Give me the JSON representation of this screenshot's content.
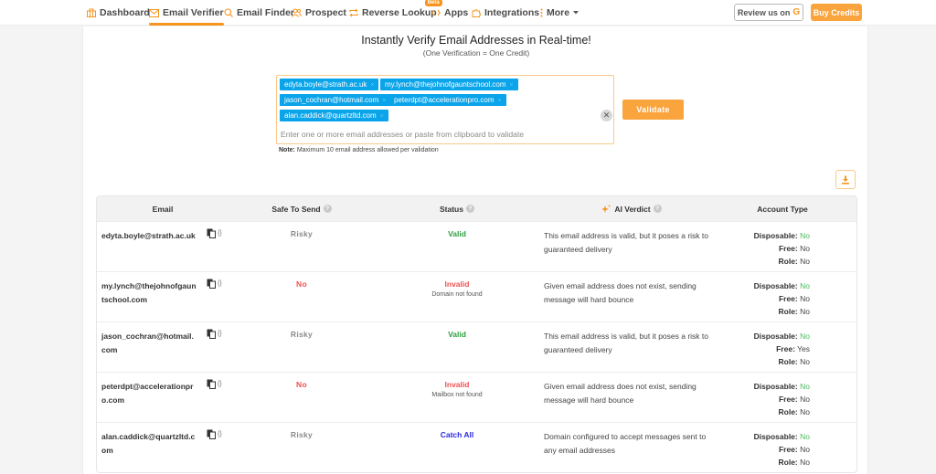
{
  "nav": {
    "items": [
      {
        "label": "Dashboard",
        "icon": "dashboard-icon",
        "active": false
      },
      {
        "label": "Email Verifier",
        "icon": "envelope-icon",
        "active": true
      },
      {
        "label": "Email Finder",
        "icon": "search-icon",
        "active": false
      },
      {
        "label": "Prospect",
        "icon": "users-icon",
        "active": false
      },
      {
        "label": "Reverse Lookup",
        "icon": "swap-icon",
        "active": false,
        "badge": "Beta"
      },
      {
        "label": "Apps",
        "icon": "code-icon",
        "active": false
      },
      {
        "label": "Integrations",
        "icon": "puzzle-icon",
        "active": false
      },
      {
        "label": "More",
        "icon": "more-vertical-icon",
        "active": false
      }
    ],
    "review_label": "Review us on",
    "review_brand_glyph": "G",
    "buy_label": "Buy Credits"
  },
  "verifier": {
    "title": "Instantly Verify Email Addresses in Real-time!",
    "subtitle": "(One Verification = One Credit)",
    "chips": [
      "edyta.boyle@strath.ac.uk",
      "my.lynch@thejohnofgauntschool.com",
      "jason_cochran@hotmail.com",
      "peterdpt@accelerationpro.com",
      "alan.caddick@quartzltd.com"
    ],
    "chip_remove_glyph": "×",
    "clear_glyph": "✕",
    "placeholder": "Enter one or more email addresses or paste from clipboard to validate",
    "validate_label": "Validate",
    "note_label": "Note:",
    "note_text": " Maximum 10 email address allowed per validation"
  },
  "table": {
    "headers": {
      "email": "Email",
      "safe": "Safe To Send",
      "status": "Status",
      "verdict": "AI Verdict",
      "account": "Account Type"
    },
    "help_glyph": "?",
    "json_glyph": "{}",
    "account_labels": {
      "disposable": "Disposable:",
      "free": "Free:",
      "role": "Role:"
    },
    "rows": [
      {
        "email": "edyta.boyle@strath.ac.uk",
        "safe": "Risky",
        "safe_class": "risky",
        "status": "Valid",
        "status_class": "valid",
        "reason": "",
        "verdict": "This email address is valid, but it poses a risk to guaranteed delivery",
        "disposable": "No",
        "free": "No",
        "role": "No"
      },
      {
        "email": "my.lynch@thejohnofgauntschool.com",
        "safe": "No",
        "safe_class": "no",
        "status": "Invalid",
        "status_class": "invalid",
        "reason": "Domain not found",
        "verdict": "Given email address does not exist, sending message will hard bounce",
        "disposable": "No",
        "free": "No",
        "role": "No"
      },
      {
        "email": "jason_cochran@hotmail.com",
        "safe": "Risky",
        "safe_class": "risky",
        "status": "Valid",
        "status_class": "valid",
        "reason": "",
        "verdict": "This email address is valid, but it poses a risk to guaranteed delivery",
        "disposable": "No",
        "free": "Yes",
        "role": "No"
      },
      {
        "email": "peterdpt@accelerationpro.com",
        "safe": "No",
        "safe_class": "no",
        "status": "Invalid",
        "status_class": "invalid",
        "reason": "Mailbox not found",
        "verdict": "Given email address does not exist, sending message will hard bounce",
        "disposable": "No",
        "free": "No",
        "role": "No"
      },
      {
        "email": "alan.caddick@quartzltd.com",
        "safe": "Risky",
        "safe_class": "risky",
        "status": "Catch All",
        "status_class": "catch",
        "reason": "",
        "verdict": "Domain configured to accept messages sent to any email addresses",
        "disposable": "No",
        "free": "No",
        "role": "No"
      }
    ]
  },
  "colors": {
    "accent": "#f7941d",
    "chip": "#0aa4ea",
    "valid": "#2e9e3e",
    "invalid": "#f0504f",
    "catch_all": "#2a2ae0",
    "disposable_no": "#48bb5b"
  }
}
